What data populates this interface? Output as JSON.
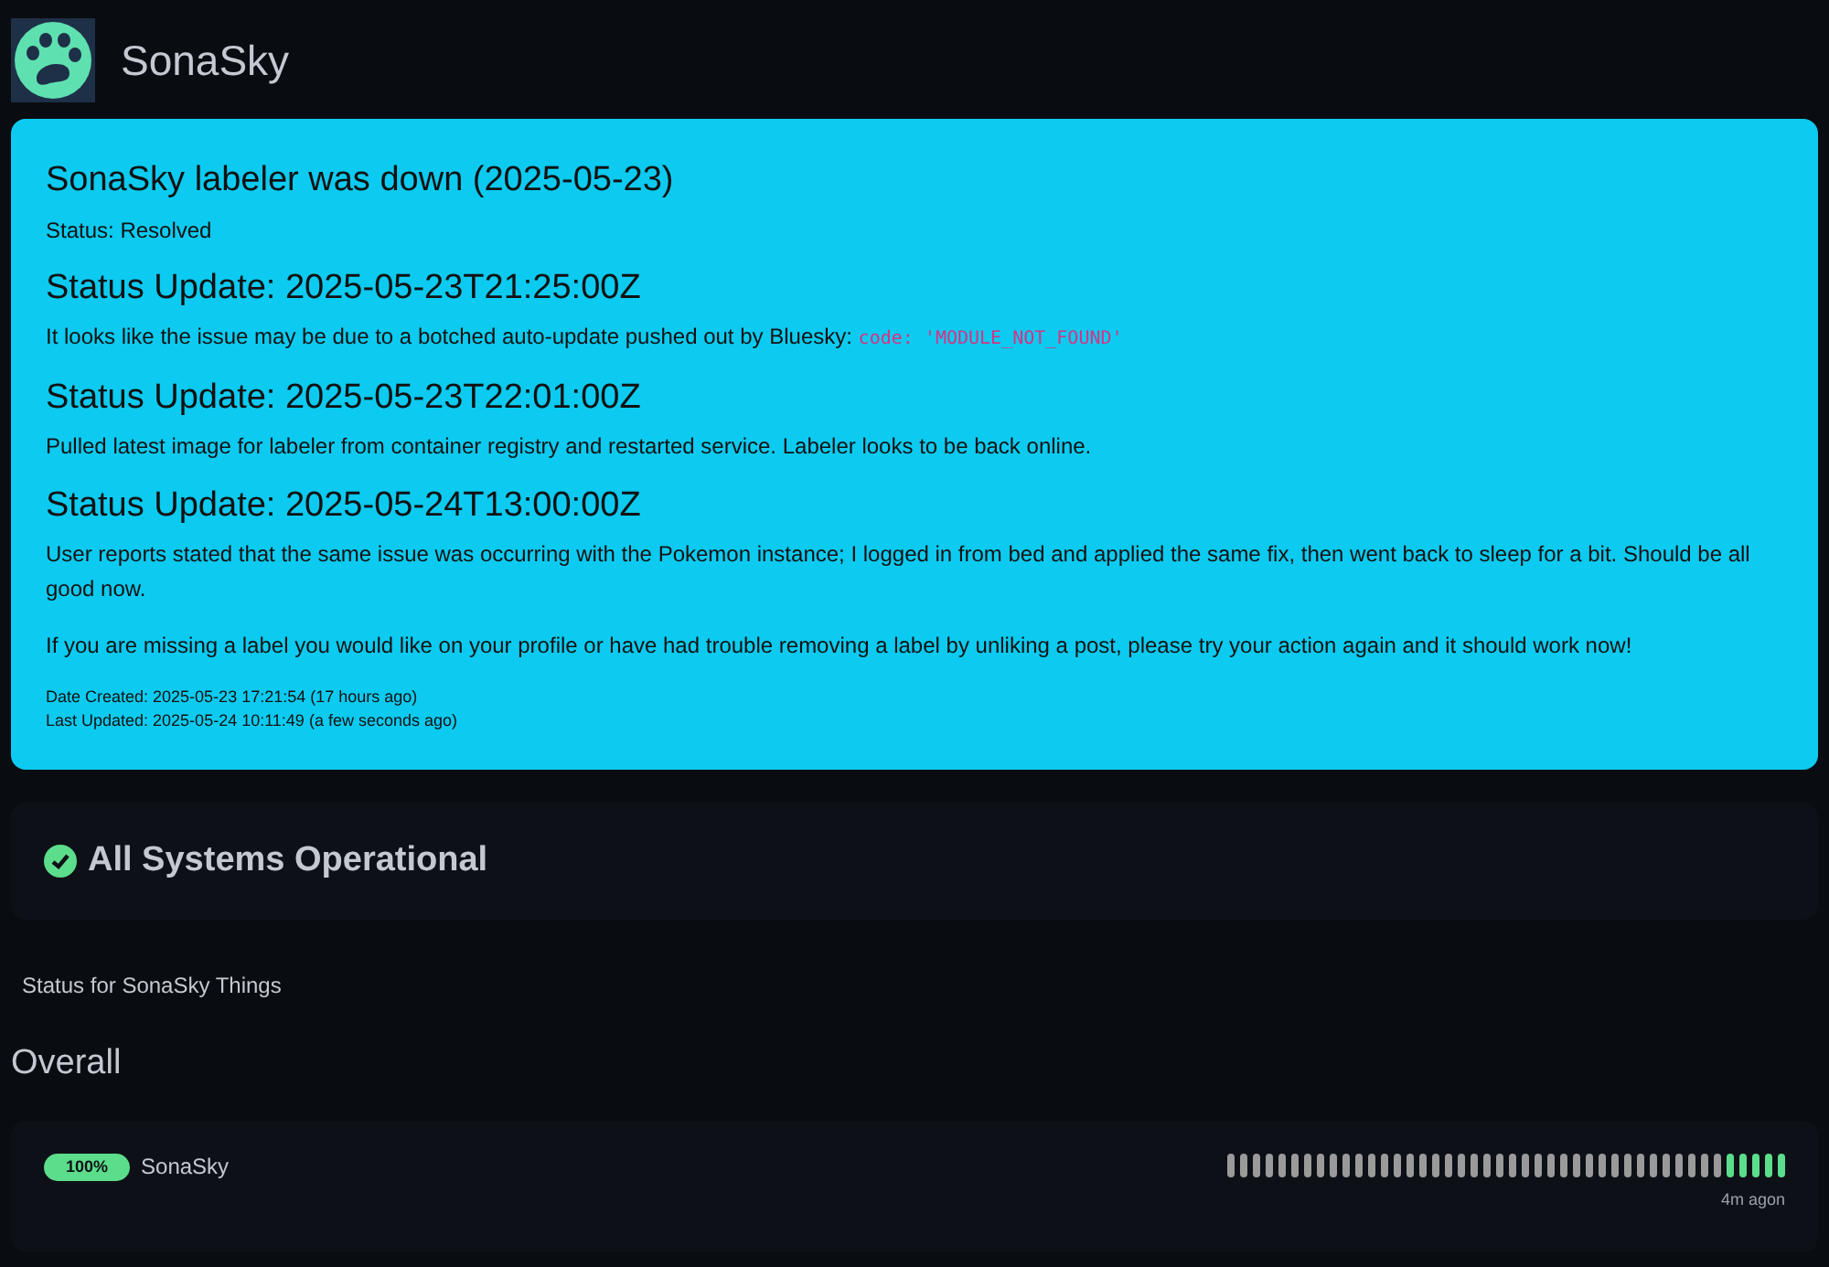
{
  "header": {
    "title": "SonaSky"
  },
  "incident": {
    "title": "SonaSky labeler was down (2025-05-23)",
    "status": "Status: Resolved",
    "updates": [
      {
        "heading": "Status Update: 2025-05-23T21:25:00Z",
        "paragraphs": [
          {
            "text": "It looks like the issue may be due to a botched auto-update pushed out by Bluesky:",
            "code": "code: 'MODULE_NOT_FOUND'"
          }
        ]
      },
      {
        "heading": "Status Update: 2025-05-23T22:01:00Z",
        "paragraphs": [
          {
            "text": "Pulled latest image for labeler from container registry and restarted service. Labeler looks to be back online."
          }
        ]
      },
      {
        "heading": "Status Update: 2025-05-24T13:00:00Z",
        "paragraphs": [
          {
            "text": "User reports stated that the same issue was occurring with the Pokemon instance; I logged in from bed and applied the same fix, then went back to sleep for a bit. Should be all good now."
          },
          {
            "text": "If you are missing a label you would like on your profile or have had trouble removing a label by unliking a post, please try your action again and it should work now!"
          }
        ]
      }
    ],
    "date_created": "Date Created: 2025-05-23 17:21:54 (17 hours ago)",
    "last_updated": "Last Updated: 2025-05-24 10:11:49 (a few seconds ago)"
  },
  "overall_status": {
    "text": "All Systems Operational"
  },
  "description": "Status for SonaSky Things",
  "group": {
    "title": "Overall",
    "monitors": [
      {
        "uptime": "100%",
        "name": "SonaSky",
        "time": "4m agon",
        "beats": [
          {
            "up": false
          },
          {
            "up": false
          },
          {
            "up": false
          },
          {
            "up": false
          },
          {
            "up": false
          },
          {
            "up": false
          },
          {
            "up": false
          },
          {
            "up": false
          },
          {
            "up": false
          },
          {
            "up": false
          },
          {
            "up": false
          },
          {
            "up": false
          },
          {
            "up": false
          },
          {
            "up": false
          },
          {
            "up": false
          },
          {
            "up": false
          },
          {
            "up": false
          },
          {
            "up": false
          },
          {
            "up": false
          },
          {
            "up": false
          },
          {
            "up": false
          },
          {
            "up": false
          },
          {
            "up": false
          },
          {
            "up": false
          },
          {
            "up": false
          },
          {
            "up": false
          },
          {
            "up": false
          },
          {
            "up": false
          },
          {
            "up": false
          },
          {
            "up": false
          },
          {
            "up": false
          },
          {
            "up": false
          },
          {
            "up": false
          },
          {
            "up": false
          },
          {
            "up": false
          },
          {
            "up": false
          },
          {
            "up": false
          },
          {
            "up": false
          },
          {
            "up": false
          },
          {
            "up": true
          },
          {
            "up": true
          },
          {
            "up": true
          },
          {
            "up": true
          },
          {
            "up": true
          }
        ]
      }
    ]
  }
}
